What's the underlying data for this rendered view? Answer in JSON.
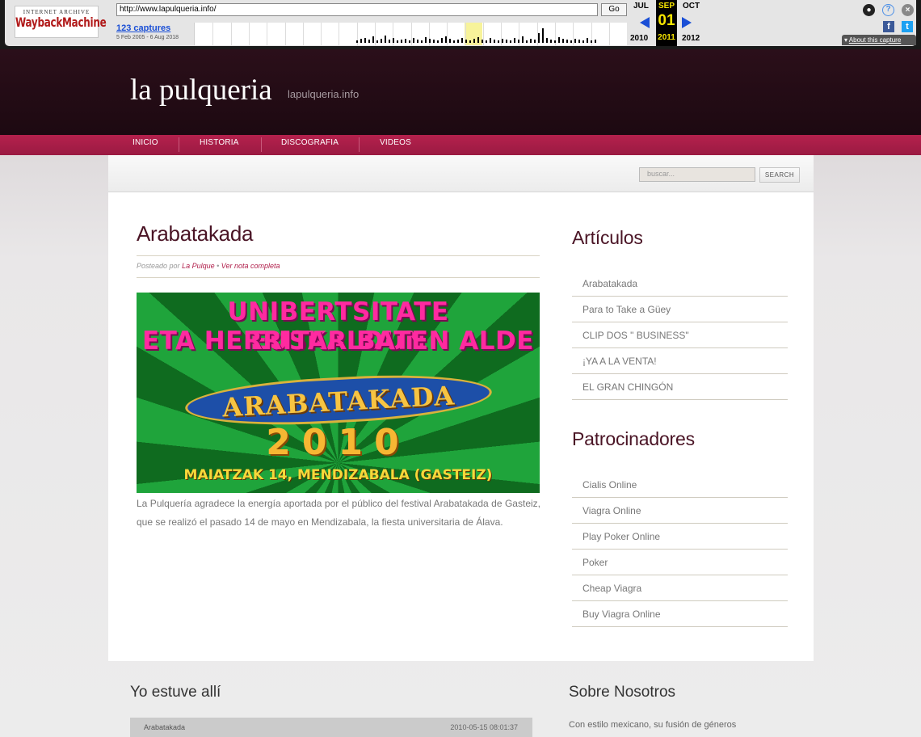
{
  "wayback": {
    "logo_top": "INTERNET ARCHIVE",
    "logo_main": "WaybackMachine",
    "url": "http://www.lapulqueria.info/",
    "go_label": "Go",
    "captures": "123 captures",
    "range": "5 Feb 2005 - 6 Aug 2018",
    "months": {
      "prev": "JUL",
      "current": "SEP",
      "next": "OCT"
    },
    "day": "01",
    "years": {
      "prev": "2010",
      "current": "2011",
      "next": "2012"
    },
    "about": "About this capture"
  },
  "site": {
    "title": "la pulqueria",
    "tagline": "lapulqueria.info"
  },
  "nav": {
    "items": [
      {
        "label": "INICIO"
      },
      {
        "label": "HISTORIA"
      },
      {
        "label": "DISCOGRAFIA"
      },
      {
        "label": "VIDEOS"
      }
    ]
  },
  "search": {
    "placeholder": "buscar...",
    "button": "SEARCH"
  },
  "post": {
    "title": "Arabatakada",
    "meta_prefix": "Posteado por",
    "author": "La Pulque",
    "separator": "•",
    "read_more": "Ver nota completa",
    "image": {
      "line1": "UNIBERTSITATE EUSKALDUN",
      "line2": "ETA HERRITAR BATEN ALDE",
      "banner": "ARABATAKADA",
      "year": "2010",
      "date": "MAIATZAK 14, MENDIZABALA (GASTEIZ)"
    },
    "body": "La Pulquería agradece la energía aportada por el público del festival Arabatakada de Gasteiz, que se realizó el pasado 14 de mayo en Mendizabala, la fiesta universitaria de Álava."
  },
  "sidebar": {
    "articulos_title": "Artículos",
    "articulos": [
      {
        "label": "Arabatakada"
      },
      {
        "label": "Para to Take a Güey"
      },
      {
        "label": "CLIP DOS \" BUSINESS\""
      },
      {
        "label": "¡YA A LA VENTA!"
      },
      {
        "label": "EL GRAN CHINGÓN"
      }
    ],
    "patrocinadores_title": "Patrocinadores",
    "patrocinadores": [
      {
        "label": "Cialis Online"
      },
      {
        "label": "Viagra Online"
      },
      {
        "label": "Play Poker Online"
      },
      {
        "label": "Poker"
      },
      {
        "label": "Cheap Viagra"
      },
      {
        "label": "Buy Viagra Online"
      }
    ]
  },
  "footer": {
    "yo_title": "Yo estuve allí",
    "yo_row": {
      "title": "Arabatakada",
      "date": "2010-05-15 08:01:37"
    },
    "sobre_title": "Sobre Nosotros",
    "sobre_text": "Con estilo mexicano, su fusión de géneros"
  },
  "colors": {
    "header_bg": "#2b0f1a",
    "nav_bg": "#b5214d",
    "title_color": "#4a1425",
    "link_color": "#b01e4a"
  }
}
